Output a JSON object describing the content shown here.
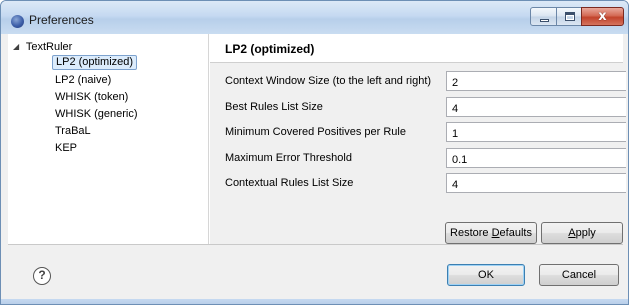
{
  "window": {
    "title": "Preferences",
    "minimize_icon": "minimize-icon",
    "maximize_icon": "maximize-icon",
    "close_icon": "close-icon",
    "close_glyph": "x"
  },
  "tree": {
    "root_label": "TextRuler",
    "root_expanded_icon": "expanded-triangle-icon",
    "items": [
      {
        "label": "LP2 (optimized)",
        "selected": true
      },
      {
        "label": "LP2 (naive)",
        "selected": false
      },
      {
        "label": "WHISK (token)",
        "selected": false
      },
      {
        "label": "WHISK (generic)",
        "selected": false
      },
      {
        "label": "TraBaL",
        "selected": false
      },
      {
        "label": "KEP",
        "selected": false
      }
    ]
  },
  "page": {
    "title": "LP2 (optimized)",
    "fields": [
      {
        "label": "Context Window Size (to the left and right)",
        "value": "2"
      },
      {
        "label": "Best Rules List Size",
        "value": "4"
      },
      {
        "label": "Minimum Covered Positives per Rule",
        "value": "1"
      },
      {
        "label": "Maximum Error Threshold",
        "value": "0.1"
      },
      {
        "label": "Contextual Rules List Size",
        "value": "4"
      }
    ],
    "restore_defaults_label": "Restore Defaults",
    "apply_label": "Apply"
  },
  "footer": {
    "help_icon": "help-icon",
    "help_glyph": "?",
    "ok_label": "OK",
    "cancel_label": "Cancel"
  }
}
